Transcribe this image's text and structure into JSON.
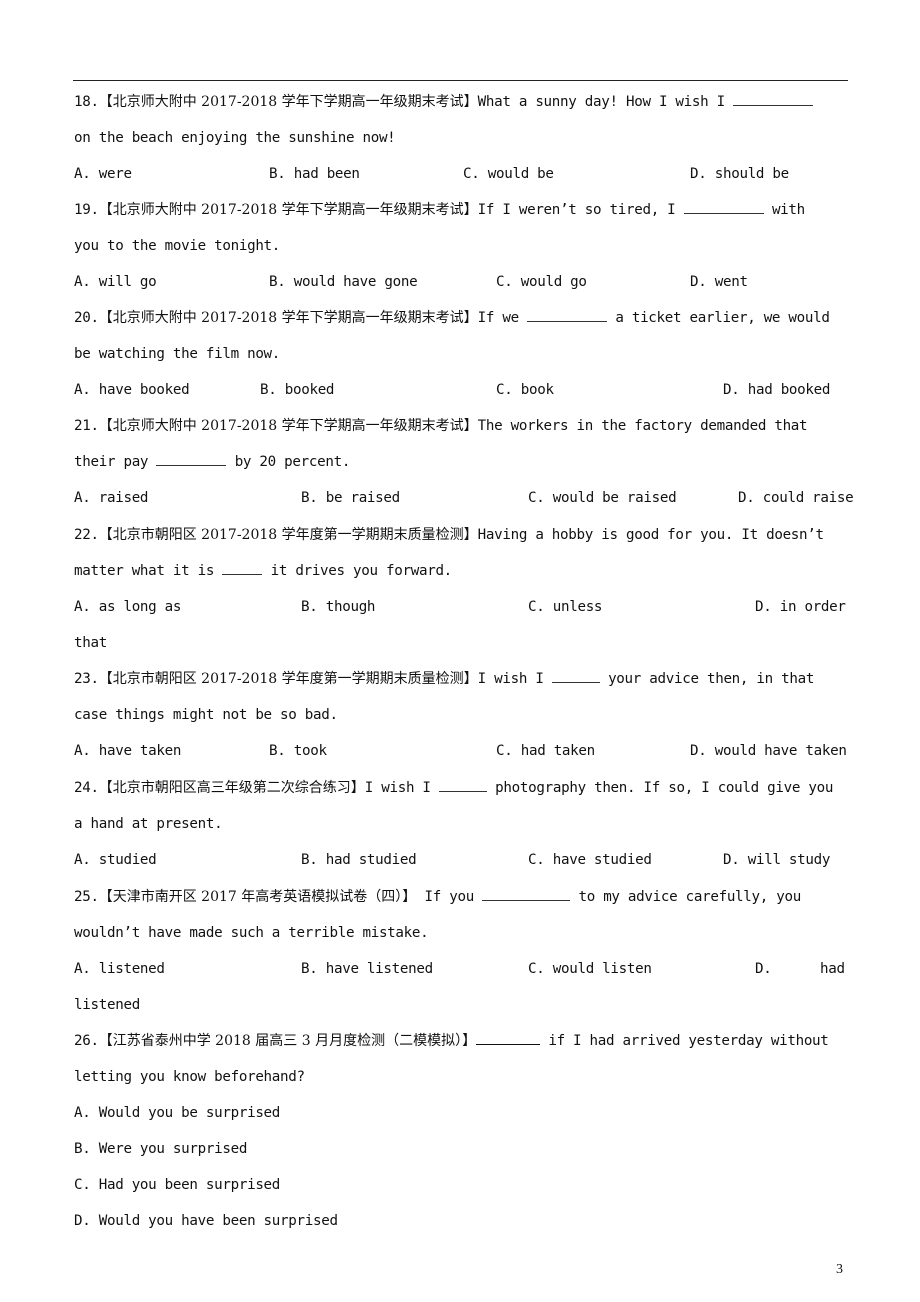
{
  "page_number": "3",
  "questions": [
    {
      "number": "18.",
      "source": "【北京师大附中 2017-2018 学年下学期高一年级期末考试】",
      "stem_before": "What a sunny day! How I wish I",
      "stem_after_line1": "",
      "line2": "on the beach enjoying the sunshine now!",
      "options": [
        "A. were",
        "B. had been",
        "C. would be",
        "D. should be"
      ]
    },
    {
      "number": "19.",
      "source": "【北京师大附中 2017-2018 学年下学期高一年级期末考试】",
      "stem_before": "If I weren’t so tired, I",
      "stem_after_line1": "with",
      "line2": "you to the movie tonight.",
      "options": [
        "A. will go",
        "B. would have gone",
        "C. would go",
        "D. went"
      ]
    },
    {
      "number": "20.",
      "source": "【北京师大附中 2017-2018 学年下学期高一年级期末考试】",
      "stem_before": "If we",
      "stem_after_line1": "a ticket earlier, we would",
      "line2": "be watching the film now.",
      "options": [
        "A. have booked",
        "B. booked",
        "C. book",
        "D. had booked"
      ]
    },
    {
      "number": "21.",
      "source": "【北京师大附中 2017-2018 学年下学期高一年级期末考试】",
      "stem_before": "The workers in the factory demanded that",
      "line2_before": "their pay",
      "line2_after": "by 20 percent.",
      "options": [
        "A. raised",
        "B. be raised",
        "C. would be raised",
        "D. could raise"
      ]
    },
    {
      "number": "22.",
      "source": "【北京市朝阳区 2017-2018 学年度第一学期期末质量检测】",
      "stem_before": "Having a hobby is good for you. It doesn’t",
      "line2_before": "matter what it is",
      "line2_after": "it drives you forward.",
      "options": [
        "A. as long as",
        "B. though",
        "C. unless",
        "D. in order"
      ],
      "overflow": "that"
    },
    {
      "number": "23.",
      "source": "【北京市朝阳区 2017-2018 学年度第一学期期末质量检测】",
      "stem_before": "I wish I",
      "stem_after_line1": "your advice then, in that",
      "line2": "case things might not be so bad.",
      "options": [
        "A. have taken",
        "B. took",
        "C. had taken",
        "D. would have taken"
      ]
    },
    {
      "number": "24.",
      "source": "【北京市朝阳区高三年级第二次综合练习】",
      "stem_before": "I wish I",
      "stem_after_line1": "photography then. If so, I could give you",
      "line2": "a hand at present.",
      "options": [
        "A. studied",
        "B. had studied",
        "C. have studied",
        "D. will study"
      ]
    },
    {
      "number": "25.",
      "source": "【天津市南开区 2017 年高考英语模拟试卷（四）】",
      "stem_before": "If you",
      "stem_after_line1": "to my advice carefully, you",
      "line2": "wouldn’t have made such a terrible mistake.",
      "options": [
        "A. listened",
        "B. have listened",
        "C. would listen",
        "D.",
        "had"
      ],
      "overflow": "listened"
    },
    {
      "number": "26.",
      "source": "【江苏省泰州中学 2018 届高三 3 月月度检测（二模模拟）】",
      "stem_before": "",
      "stem_after_line1": "if I had arrived yesterday without",
      "line2": "letting you know beforehand?",
      "options": [
        "A. Would you be surprised",
        "B. Were you surprised",
        "C. Had you been surprised",
        "D. Would you have been surprised"
      ]
    }
  ]
}
